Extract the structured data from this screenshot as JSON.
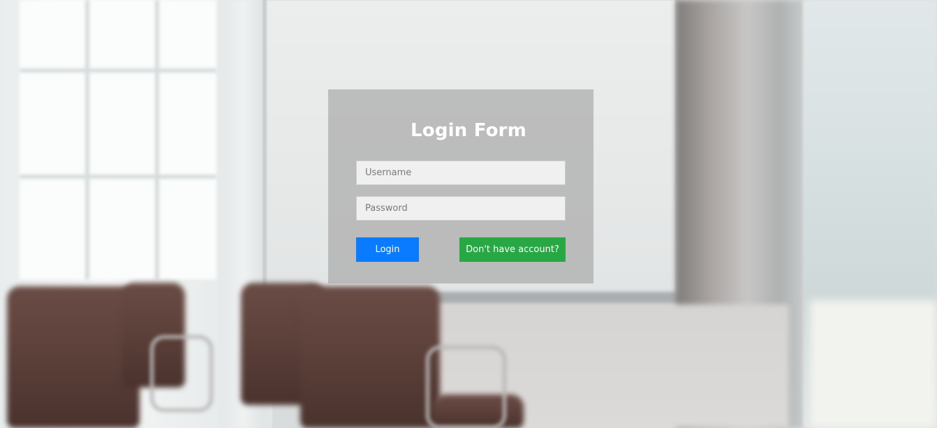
{
  "login_form": {
    "title": "Login Form",
    "username": {
      "placeholder": "Username",
      "value": ""
    },
    "password": {
      "placeholder": "Password",
      "value": ""
    },
    "login_label": "Login",
    "signup_label": "Don't have account?"
  },
  "colors": {
    "login_button": "#0a7bff",
    "signup_button": "#28a745",
    "card_overlay": "rgba(170,170,170,0.72)"
  }
}
